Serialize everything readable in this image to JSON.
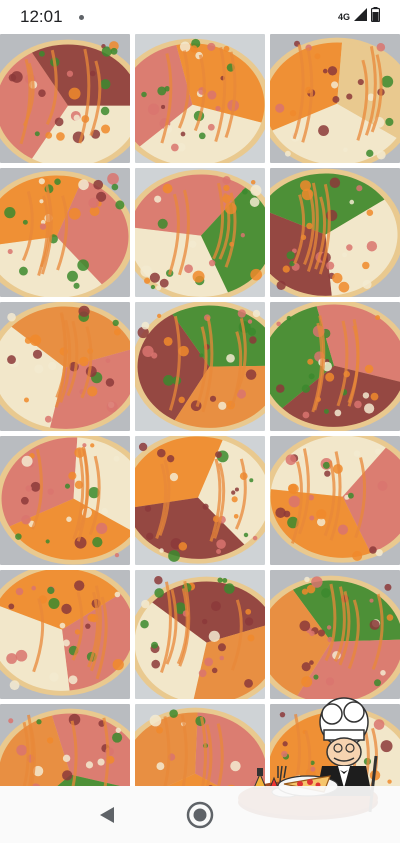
{
  "status_bar": {
    "time": "12:01",
    "network": "4G",
    "icons": [
      "notification-dot-icon",
      "signal-icon",
      "battery-icon"
    ]
  },
  "gallery": {
    "tiles": [
      {
        "name": "photo-1"
      },
      {
        "name": "photo-2"
      },
      {
        "name": "photo-3"
      },
      {
        "name": "photo-4"
      },
      {
        "name": "photo-5"
      },
      {
        "name": "photo-6"
      },
      {
        "name": "photo-7"
      },
      {
        "name": "photo-8"
      },
      {
        "name": "photo-9"
      },
      {
        "name": "photo-10"
      },
      {
        "name": "photo-11"
      },
      {
        "name": "photo-12"
      },
      {
        "name": "photo-13"
      },
      {
        "name": "photo-14"
      },
      {
        "name": "photo-15"
      },
      {
        "name": "photo-16"
      },
      {
        "name": "photo-17"
      },
      {
        "name": "photo-18"
      }
    ]
  },
  "nav_bar": {
    "buttons": [
      "back-icon",
      "home-icon"
    ]
  },
  "colors": {
    "crust": "#e9c98f",
    "cheese": "#f3ead0",
    "carrot": "#f08a2b",
    "ham": "#d9746e",
    "pepperoni": "#8c3a3a",
    "green": "#3c8a2e",
    "sauce": "#e8883a"
  }
}
